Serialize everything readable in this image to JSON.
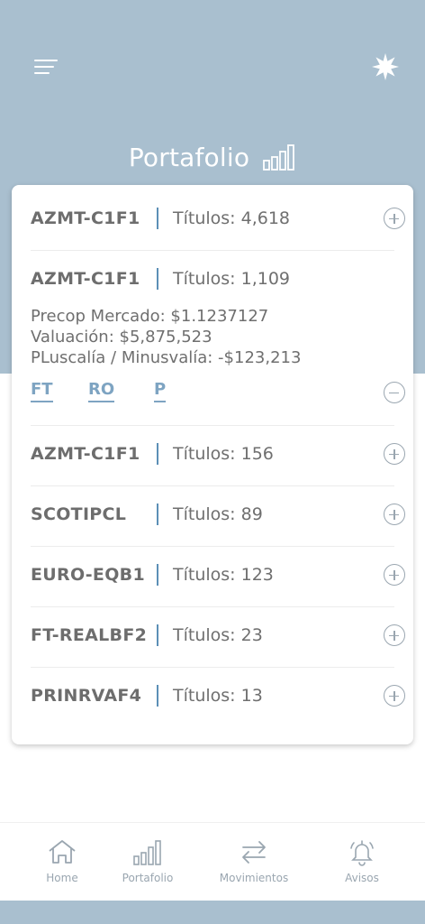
{
  "header": {
    "title": "Portafolio",
    "menu_icon": "menu-icon",
    "star_icon": "star-icon",
    "title_icon": "bar-chart-icon"
  },
  "holdings": [
    {
      "ticker": "AZMT-C1F1",
      "titles": "Títulos: 4,618",
      "expanded": false
    },
    {
      "ticker": "AZMT-C1F1",
      "titles": "Títulos: 1,109",
      "expanded": true
    },
    {
      "ticker": "AZMT-C1F1",
      "titles": "Títulos: 156",
      "expanded": false
    },
    {
      "ticker": "SCOTIPCL",
      "titles": "Títulos: 89",
      "expanded": false
    },
    {
      "ticker": "EURO-EQB1",
      "titles": "Títulos: 123",
      "expanded": false
    },
    {
      "ticker": "FT-REALBF2",
      "titles": "Títulos: 23",
      "expanded": false
    },
    {
      "ticker": "PRINRVAF4",
      "titles": "Títulos: 13",
      "expanded": false
    }
  ],
  "expanded_details": {
    "precio": "Precop Mercado: $1.1237127",
    "valuacion": "Valuación: $5,875,523",
    "plusvalia": "PLuscalía / Minusvalía: -$123,213",
    "links": [
      "FT",
      "RO",
      "P"
    ]
  },
  "nav": [
    {
      "label": "Home",
      "icon": "home-icon"
    },
    {
      "label": "Portafolio",
      "icon": "bar-chart-icon"
    },
    {
      "label": "Movimientos",
      "icon": "transfer-arrows-icon"
    },
    {
      "label": "Avisos",
      "icon": "bell-icon"
    }
  ],
  "colors": {
    "header_bg": "#a9bfcf",
    "accent": "#5c8fb6",
    "link": "#7ea4c2",
    "text": "#6d6d6d"
  }
}
